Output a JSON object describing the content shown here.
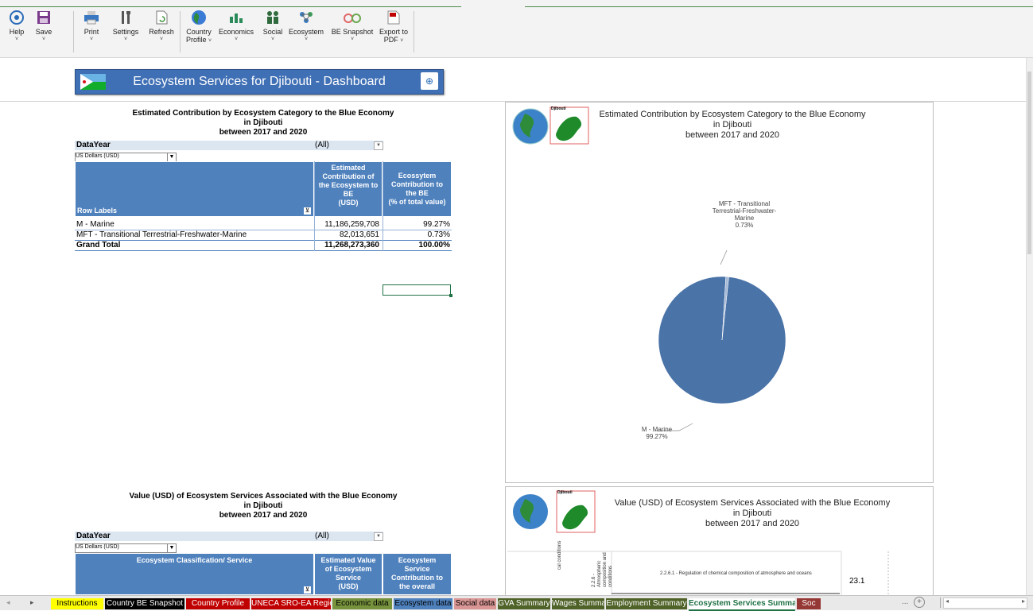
{
  "ribbon": {
    "buttons": [
      {
        "name": "help-button",
        "label": "Help",
        "icon": "un-logo-icon"
      },
      {
        "name": "save-button",
        "label": "Save",
        "icon": "floppy-icon"
      },
      {
        "name": "print-button",
        "label": "Print",
        "icon": "printer-icon"
      },
      {
        "name": "settings-button",
        "label": "Settings",
        "icon": "tools-icon"
      },
      {
        "name": "refresh-button",
        "label": "Refresh",
        "icon": "refresh-icon"
      },
      {
        "name": "country-profile-button",
        "label": "Country",
        "label2": "Profile",
        "icon": "globe-icon"
      },
      {
        "name": "economics-button",
        "label": "Economics",
        "icon": "economics-icon"
      },
      {
        "name": "social-button",
        "label": "Social",
        "icon": "people-icon"
      },
      {
        "name": "ecosystem-button",
        "label": "Ecosystem",
        "icon": "ecosystem-icon"
      },
      {
        "name": "be-snapshot-button",
        "label": "BE Snapshot",
        "icon": "snapshot-icon"
      },
      {
        "name": "export-pdf-button",
        "label": "Export to",
        "label2": "PDF",
        "icon": "pdf-icon"
      }
    ]
  },
  "banner": {
    "title": "Ecosystem Services for Djibouti - Dashboard"
  },
  "pivot1": {
    "title1": "Estimated Contribution by Ecosystem Category to the Blue Economy",
    "title2": "in Djibouti",
    "title3": "between 2017 and 2020",
    "filter_label": "DataYear",
    "filter_value": "(All)",
    "currency": "US Dollars (USD)",
    "row_labels": "Row Labels",
    "col1_l1": "Estimated",
    "col1_l2": "Contribution of",
    "col1_l3": "the Ecosystem to",
    "col1_l4": "BE",
    "col1_l5": "(USD)",
    "col2_l1": "Ecossytem",
    "col2_l2": "Contribution to",
    "col2_l3": "the BE",
    "col2_l4": "(% of total value)",
    "rows": [
      {
        "label": "M - Marine",
        "value": "11,186,259,708",
        "pct": "99.27%"
      },
      {
        "label": "MFT - Transitional Terrestrial-Freshwater-Marine",
        "value": "82,013,651",
        "pct": "0.73%"
      }
    ],
    "total": {
      "label": "Grand Total",
      "value": "11,268,273,360",
      "pct": "100.00%"
    }
  },
  "chart1": {
    "title1": "Estimated Contribution by Ecosystem Category to the Blue Economy",
    "title2": "in Djibouti",
    "title3": "between 2017 and 2020",
    "map_label": "Djibouti",
    "label_mft1": "MFT - Transitional",
    "label_mft2": "Terrestrial-Freshwater-",
    "label_mft3": "Marine",
    "label_mft4": "0.73%",
    "label_m1": "M - Marine",
    "label_m2": "99.27%"
  },
  "chart_data": [
    {
      "type": "pie",
      "title": "Estimated Contribution by Ecosystem Category to the Blue Economy in Djibouti between 2017 and 2020",
      "categories": [
        "M - Marine",
        "MFT - Transitional Terrestrial-Freshwater-Marine"
      ],
      "values": [
        99.27,
        0.73
      ],
      "colors": [
        "#4a73a8",
        "#a7bad6"
      ]
    }
  ],
  "pivot2": {
    "title1": "Value (USD) of Ecosystem Services Associated with the Blue Economy",
    "title2": "in Djibouti",
    "title3": "between 2017 and 2020",
    "filter_label": "DataYear",
    "filter_value": "(All)",
    "currency": "US Dollars (USD)",
    "col0": "Ecosystem Classification/ Service",
    "col1_l1": "Estimated Value",
    "col1_l2": "of Ecosystem",
    "col1_l3": "Service",
    "col1_l4": "(USD)",
    "col2_l1": "Ecosystem",
    "col2_l2": "Service",
    "col2_l3": "Contribution to",
    "col2_l4": "the overall"
  },
  "chart2": {
    "title1": "Value (USD) of Ecosystem Services Associated with the Blue Economy",
    "title2": "in Djibouti",
    "title3": "between 2017 and 2020",
    "map_label": "Djibouti",
    "axis_a": "cal conditions",
    "axis_b": "2.2.6 -",
    "axis_c": "Atmospheric",
    "axis_d": "composition and",
    "axis_e": "conditions",
    "bar_label": "2.2.6.1 - Regulation of chemical composition of atmosphere and oceans",
    "bar_value": "23.1"
  },
  "tabs": [
    {
      "label": "Instructions",
      "bg": "#ffff00",
      "fg": "#000"
    },
    {
      "label": "Country BE Snapshot",
      "bg": "#000000",
      "fg": "#fff"
    },
    {
      "label": "Country Profile",
      "bg": "#c00000",
      "fg": "#fff"
    },
    {
      "label": "UNECA SRO-EA Region",
      "bg": "#c00000",
      "fg": "#fff"
    },
    {
      "label": "Economic data",
      "bg": "#76923c",
      "fg": "#000"
    },
    {
      "label": "Ecosystem data",
      "bg": "#4f81bd",
      "fg": "#000"
    },
    {
      "label": "Social data",
      "bg": "#d99694",
      "fg": "#000"
    },
    {
      "label": "GVA Summary",
      "bg": "#4f6228",
      "fg": "#fff"
    },
    {
      "label": "Wages Summary",
      "bg": "#4f6228",
      "fg": "#fff"
    },
    {
      "label": "Employment Summary",
      "bg": "#4f6228",
      "fg": "#fff"
    },
    {
      "label": "Ecosystem Services Summary",
      "bg": "#ffffff",
      "fg": "#217346"
    },
    {
      "label": "Soc",
      "bg": "#953735",
      "fg": "#fff"
    }
  ],
  "tabs_more": "..."
}
